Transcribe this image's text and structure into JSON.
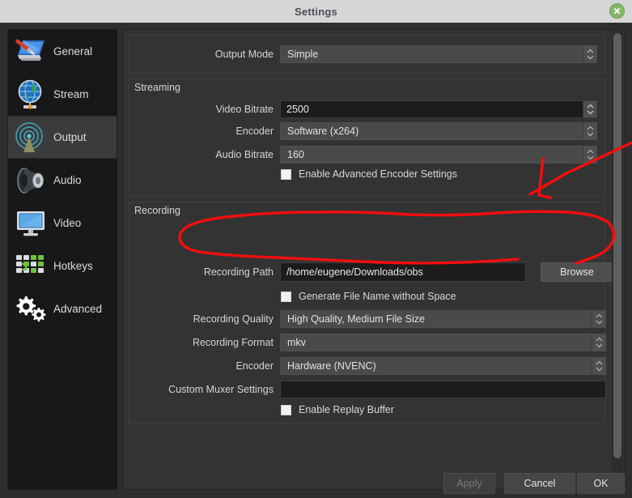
{
  "window": {
    "title": "Settings",
    "close_icon": "close-x-icon",
    "close_color": "#84b868"
  },
  "sidebar": {
    "items": [
      {
        "label": "General",
        "icon": "general-screwdriver-monitor-icon",
        "selected": false
      },
      {
        "label": "Stream",
        "icon": "stream-globe-icon",
        "selected": false
      },
      {
        "label": "Output",
        "icon": "output-broadcast-icon",
        "selected": true
      },
      {
        "label": "Audio",
        "icon": "audio-speaker-icon",
        "selected": false
      },
      {
        "label": "Video",
        "icon": "video-monitor-icon",
        "selected": false
      },
      {
        "label": "Hotkeys",
        "icon": "hotkeys-keyboard-icon",
        "selected": false
      },
      {
        "label": "Advanced",
        "icon": "advanced-gears-icon",
        "selected": false
      }
    ]
  },
  "output_mode": {
    "label": "Output Mode",
    "value": "Simple"
  },
  "streaming": {
    "title": "Streaming",
    "video_bitrate": {
      "label": "Video Bitrate",
      "value": "2500"
    },
    "encoder": {
      "label": "Encoder",
      "value": "Software (x264)"
    },
    "audio_bitrate": {
      "label": "Audio Bitrate",
      "value": "160"
    },
    "advanced_encoder": {
      "label": "Enable Advanced Encoder Settings",
      "checked": false
    }
  },
  "recording": {
    "title": "Recording",
    "path": {
      "label": "Recording Path",
      "value": "/home/eugene/Downloads/obs"
    },
    "browse": {
      "label": "Browse"
    },
    "no_space": {
      "label": "Generate File Name without Space",
      "checked": false
    },
    "quality": {
      "label": "Recording Quality",
      "value": "High Quality, Medium File Size"
    },
    "format": {
      "label": "Recording Format",
      "value": "mkv"
    },
    "encoder": {
      "label": "Encoder",
      "value": "Hardware (NVENC)"
    },
    "muxer": {
      "label": "Custom Muxer Settings",
      "value": ""
    },
    "replay_buffer": {
      "label": "Enable Replay Buffer",
      "checked": false
    }
  },
  "buttons": {
    "apply": "Apply",
    "cancel": "Cancel",
    "ok": "OK"
  },
  "annotations": {
    "color": "#f60d0d",
    "arrow_name": "red-arrow-annotation",
    "ellipse_name": "red-ellipse-annotation"
  }
}
